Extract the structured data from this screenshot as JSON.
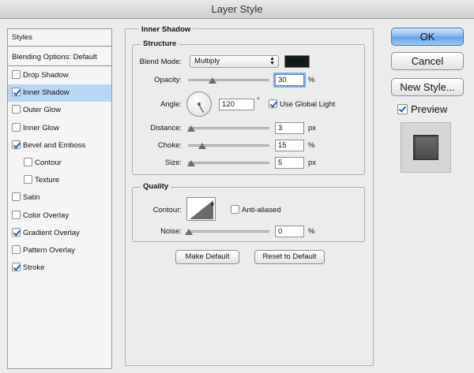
{
  "window": {
    "title": "Layer Style"
  },
  "sidebar": {
    "header": "Styles",
    "blending": "Blending Options: Default",
    "items": [
      {
        "label": "Drop Shadow",
        "checked": false,
        "indent": false,
        "selected": false
      },
      {
        "label": "Inner Shadow",
        "checked": true,
        "indent": false,
        "selected": true
      },
      {
        "label": "Outer Glow",
        "checked": false,
        "indent": false,
        "selected": false
      },
      {
        "label": "Inner Glow",
        "checked": false,
        "indent": false,
        "selected": false
      },
      {
        "label": "Bevel and Emboss",
        "checked": true,
        "indent": false,
        "selected": false
      },
      {
        "label": "Contour",
        "checked": false,
        "indent": true,
        "selected": false
      },
      {
        "label": "Texture",
        "checked": false,
        "indent": true,
        "selected": false
      },
      {
        "label": "Satin",
        "checked": false,
        "indent": false,
        "selected": false
      },
      {
        "label": "Color Overlay",
        "checked": false,
        "indent": false,
        "selected": false
      },
      {
        "label": "Gradient Overlay",
        "checked": true,
        "indent": false,
        "selected": false
      },
      {
        "label": "Pattern Overlay",
        "checked": false,
        "indent": false,
        "selected": false
      },
      {
        "label": "Stroke",
        "checked": true,
        "indent": false,
        "selected": false
      }
    ]
  },
  "panel": {
    "title": "Inner Shadow",
    "structure": {
      "title": "Structure",
      "blend_mode_label": "Blend Mode:",
      "blend_mode": "Multiply",
      "shadow_color": "#141a1a",
      "opacity_label": "Opacity:",
      "opacity": "30",
      "opacity_unit": "%",
      "angle_label": "Angle:",
      "angle": "120",
      "angle_unit": "°",
      "global_light_label": "Use Global Light",
      "global_light": true,
      "distance_label": "Distance:",
      "distance": "3",
      "distance_unit": "px",
      "choke_label": "Choke:",
      "choke": "15",
      "choke_unit": "%",
      "size_label": "Size:",
      "size": "5",
      "size_unit": "px"
    },
    "quality": {
      "title": "Quality",
      "contour_label": "Contour:",
      "anti_aliased_label": "Anti-aliased",
      "anti_aliased": false,
      "noise_label": "Noise:",
      "noise": "0",
      "noise_unit": "%"
    },
    "make_default": "Make Default",
    "reset_default": "Reset to Default"
  },
  "actions": {
    "ok": "OK",
    "cancel": "Cancel",
    "new_style": "New Style...",
    "preview_label": "Preview",
    "preview": true
  },
  "colors": {
    "selection": "#b9d6f5",
    "accent": "#5fa0e6"
  }
}
